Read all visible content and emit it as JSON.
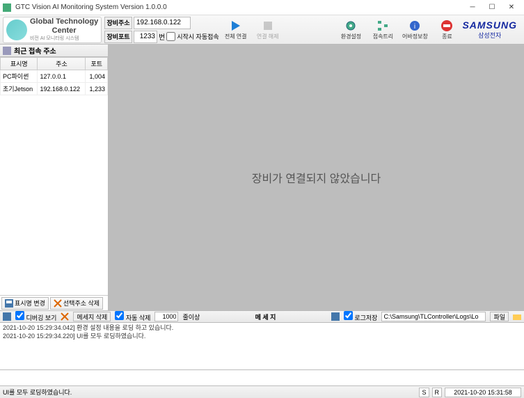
{
  "titlebar": {
    "title": "GTC Vision AI Monitoring System Version 1.0.0.0"
  },
  "logo": {
    "line1": "Global Technology",
    "line2": "Center",
    "sub": "비전 AI 모니터링 시스템"
  },
  "address": {
    "ip_label": "장비주소",
    "ip_value": "192.168.0.122",
    "port_label": "장비포트",
    "port_value": "1233",
    "port_unit": "번",
    "auto_connect": "시작시 자동접속"
  },
  "toolbar": {
    "connect_all": "전체 연결",
    "disconnect": "연결 해제",
    "settings": "환경설정",
    "tree": "접속트리",
    "info": "어바정보창",
    "exit": "종료"
  },
  "samsung": {
    "en": "SAMSUNG",
    "kr": "삼성전자"
  },
  "sidebar": {
    "header": "최근 접속 주소",
    "cols": {
      "name": "표시명",
      "addr": "주소",
      "port": "포트"
    },
    "rows": [
      {
        "name": "PC파이썬",
        "addr": "127.0.0.1",
        "port": "1,004"
      },
      {
        "name": "초기Jetson",
        "addr": "192.168.0.122",
        "port": "1,233"
      }
    ],
    "rename": "표시명 변경",
    "delete": "선택주소 삭제"
  },
  "content": {
    "message": "장비가 연결되지 않았습니다"
  },
  "msgbar": {
    "debug_view": "디버깅 보기",
    "msg_delete": "메세지 삭제",
    "auto_delete": "자동 삭제",
    "threshold": "1000",
    "threshold_unit": "줄이상",
    "title": "메 세 지",
    "log_save": "로그저장",
    "log_path": "C:\\Samsung\\TLController\\Logs\\Lo",
    "file_btn": "파일"
  },
  "logs": [
    "2021-10-20 15:29:34.042] 환경 설정 내용을 로딩 하고 있습니다.",
    "2021-10-20 15:29:34.220] UI를 모두 로딩하였습니다."
  ],
  "statusbar": {
    "left": "UI를 모두 로딩하였습니다.",
    "s": "S",
    "r": "R",
    "datetime": "2021-10-20 15:31:58"
  }
}
